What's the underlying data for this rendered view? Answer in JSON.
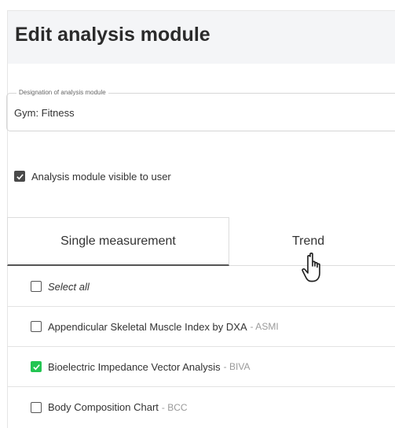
{
  "header": {
    "title": "Edit analysis module"
  },
  "designation": {
    "legend": "Designation of analysis module",
    "value": "Gym: Fitness"
  },
  "visibility": {
    "label": "Analysis module visible to user",
    "checked": true
  },
  "tabs": [
    {
      "label": "Single measurement",
      "active": true
    },
    {
      "label": "Trend",
      "active": false
    }
  ],
  "list": {
    "select_all": "Select all",
    "items": [
      {
        "label": "Appendicular Skeletal Muscle Index by DXA",
        "abbr": "- ASMI",
        "checked": false
      },
      {
        "label": "Bioelectric Impedance Vector Analysis",
        "abbr": "- BIVA",
        "checked": true
      },
      {
        "label": "Body Composition Chart",
        "abbr": "- BCC",
        "checked": false
      }
    ]
  },
  "colors": {
    "check_green": "#23c552",
    "check_dark": "#4a4a4a",
    "header_bg": "#f4f5f7"
  }
}
